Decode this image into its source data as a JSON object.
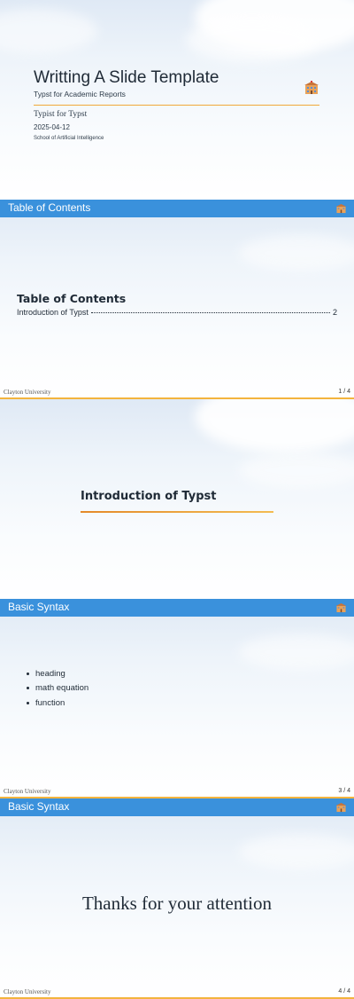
{
  "slide1": {
    "title": "Writting A Slide Template",
    "subtitle": "Typst for Academic Reports",
    "author": "Typist for Typst",
    "date": "2025-04-12",
    "institution": "School of Artificial Intelligence"
  },
  "slide2": {
    "bar_title": "Table of Contents",
    "heading": "Table of Contents",
    "toc": [
      {
        "label": "Introduction of Typst",
        "page": "2"
      }
    ],
    "footer_left": "Clayton University",
    "footer_right": "1 / 4"
  },
  "slide3": {
    "section_title": "Introduction of Typst"
  },
  "slide4": {
    "bar_title": "Basic Syntax",
    "bullets": [
      "heading",
      "math equation",
      "function"
    ],
    "footer_left": "Clayton University",
    "footer_right": "3 / 4"
  },
  "slide5": {
    "bar_title": "Basic Syntax",
    "message": "Thanks for your attention",
    "footer_left": "Clayton University",
    "footer_right": "4 / 4"
  },
  "colors": {
    "bar": "#3a91dc",
    "accent": "#f3b43e",
    "text": "#1f2a36"
  },
  "icons": {
    "logo": "university-building-icon"
  }
}
